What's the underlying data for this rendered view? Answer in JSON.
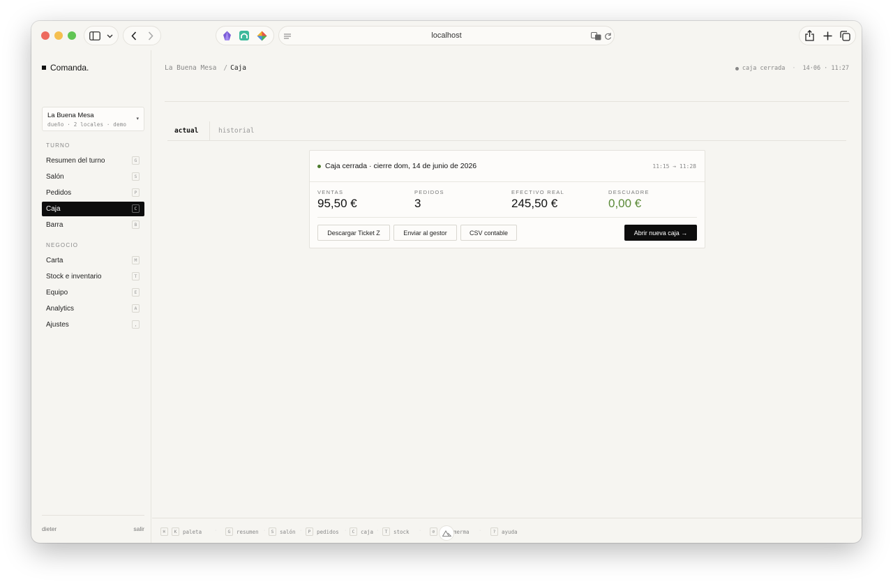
{
  "browser": {
    "url": "localhost"
  },
  "sidebar": {
    "brand": "Comanda.",
    "venue": {
      "name": "La Buena Mesa",
      "subtitle": "dueño · 2 locales · demo",
      "caret": "▾"
    },
    "sections": [
      {
        "title": "TURNO",
        "items": [
          {
            "label": "Resumen del turno",
            "key": "G",
            "active": false
          },
          {
            "label": "Salón",
            "key": "S",
            "active": false
          },
          {
            "label": "Pedidos",
            "key": "P",
            "active": false
          },
          {
            "label": "Caja",
            "key": "C",
            "active": true
          },
          {
            "label": "Barra",
            "key": "B",
            "active": false
          }
        ]
      },
      {
        "title": "NEGOCIO",
        "items": [
          {
            "label": "Carta",
            "key": "M",
            "active": false
          },
          {
            "label": "Stock e inventario",
            "key": "T",
            "active": false
          },
          {
            "label": "Equipo",
            "key": "E",
            "active": false
          },
          {
            "label": "Analytics",
            "key": "A",
            "active": false
          },
          {
            "label": "Ajustes",
            "key": ",",
            "active": false
          }
        ]
      }
    ],
    "footer": {
      "user": "dieter",
      "logout": "salir"
    }
  },
  "header": {
    "breadcrumb_root": "La Buena Mesa",
    "breadcrumb_sep": "/",
    "breadcrumb_current": "Caja",
    "status": "caja cerrada",
    "status_sep": "·",
    "datetime": "14·06 · 11:27"
  },
  "tabs": [
    {
      "label": "actual",
      "active": true
    },
    {
      "label": "historial",
      "active": false
    }
  ],
  "card": {
    "title": "Caja cerrada · cierre dom, 14 de junio de 2026",
    "time_range": "11:15 → 11:28",
    "metrics": [
      {
        "label": "VENTAS",
        "value": "95,50 €"
      },
      {
        "label": "PEDIDOS",
        "value": "3"
      },
      {
        "label": "EFECTIVO REAL",
        "value": "245,50 €"
      },
      {
        "label": "DESCUADRE",
        "value": "0,00 €",
        "color": "#5b8a38"
      }
    ],
    "buttons": {
      "ticket_z": "Descargar Ticket Z",
      "send": "Enviar al gestor",
      "csv": "CSV contable",
      "open_new": "Abrir nueva caja →"
    }
  },
  "shortcuts": [
    {
      "keys": [
        "⌘",
        "K"
      ],
      "label": "paleta"
    },
    {
      "keys": [
        "G"
      ],
      "label": "resumen"
    },
    {
      "keys": [
        "S"
      ],
      "label": "salón"
    },
    {
      "keys": [
        "P"
      ],
      "label": "pedidos"
    },
    {
      "keys": [
        "C"
      ],
      "label": "caja"
    },
    {
      "keys": [
        "T"
      ],
      "label": "stock"
    },
    {
      "keys": [
        "⊘"
      ],
      "label": "merma"
    },
    {
      "keys": [
        "?"
      ],
      "label": "ayuda"
    }
  ],
  "shortcut_sep": "·",
  "colors": {
    "accent_green": "#4b7a2c",
    "active_bg": "#0d0d0d",
    "page_bg": "#f6f5f1"
  }
}
